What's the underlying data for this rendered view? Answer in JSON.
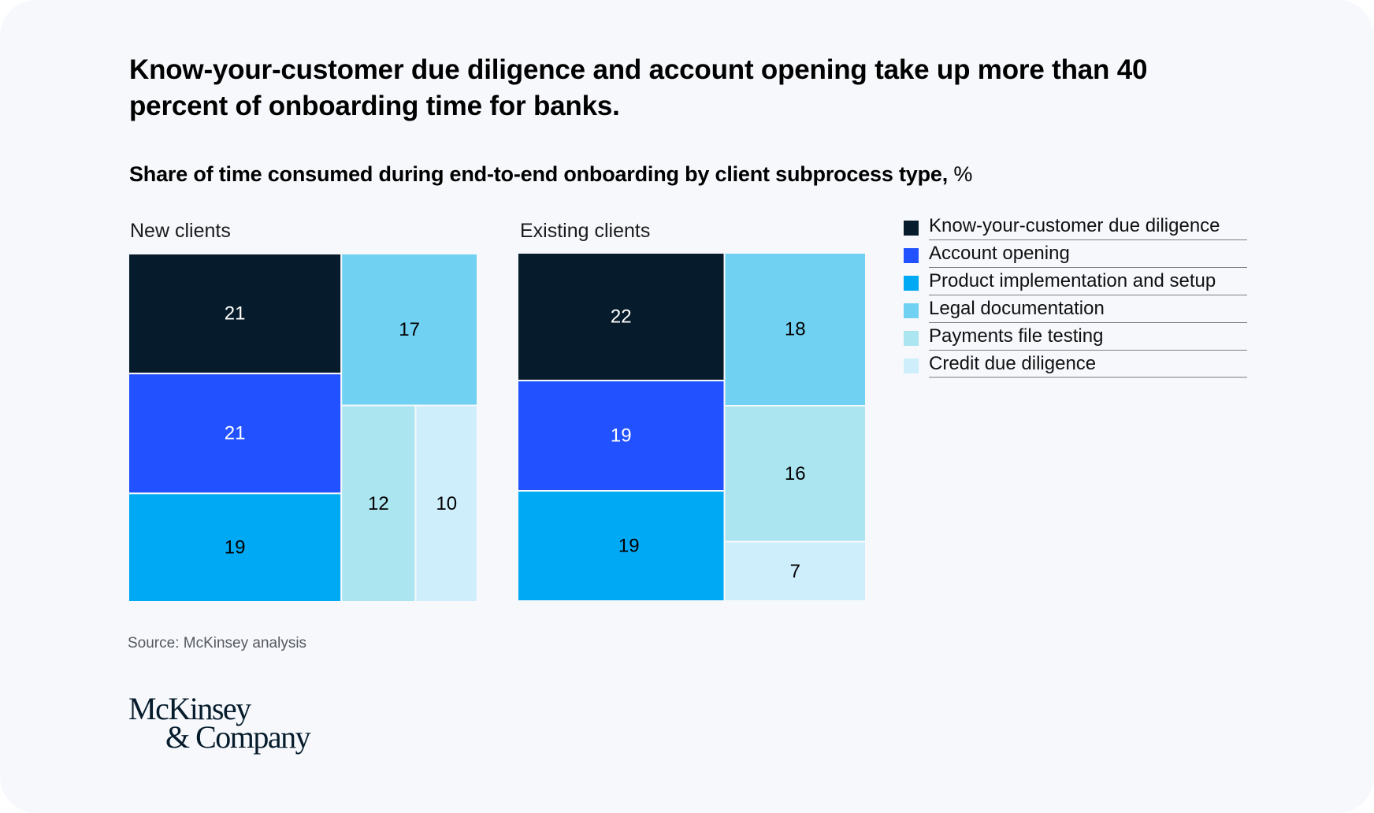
{
  "header": {
    "title": "Know-your-customer due diligence and account opening take up more than 40 percent of onboarding time for banks.",
    "subtitle": "Share of time consumed during end-to-end onboarding by client subprocess type,",
    "subtitle_unit": " %"
  },
  "footer": {
    "source": "Source: McKinsey analysis",
    "logo_line1": "McKinsey",
    "logo_line2": "& Company"
  },
  "colors": {
    "kyc": "#061c2c",
    "account": "#2251ff",
    "product": "#00a9f4",
    "legal": "#71d1f2",
    "payments": "#abe5f0",
    "credit": "#cfeefc",
    "label_light": "#ffffff",
    "label_dark": "#000000"
  },
  "chart_data": {
    "type": "treemap",
    "title": "Share of time consumed during end-to-end onboarding by client subprocess type, %",
    "unit": "%",
    "legend": {
      "placement": "right",
      "entries": [
        {
          "key": "kyc",
          "label": "Know-your-customer due diligence"
        },
        {
          "key": "account",
          "label": "Account opening"
        },
        {
          "key": "product",
          "label": "Product implementation and setup"
        },
        {
          "key": "legal",
          "label": "Legal documentation"
        },
        {
          "key": "payments",
          "label": "Payments file testing"
        },
        {
          "key": "credit",
          "label": "Credit due diligence"
        }
      ]
    },
    "panels": [
      {
        "name": "New clients",
        "values": {
          "kyc": 21,
          "account": 21,
          "product": 19,
          "legal": 17,
          "payments": 12,
          "credit": 10
        }
      },
      {
        "name": "Existing clients",
        "values": {
          "kyc": 22,
          "account": 19,
          "product": 19,
          "legal": 18,
          "payments": 16,
          "credit": 7
        }
      }
    ]
  }
}
